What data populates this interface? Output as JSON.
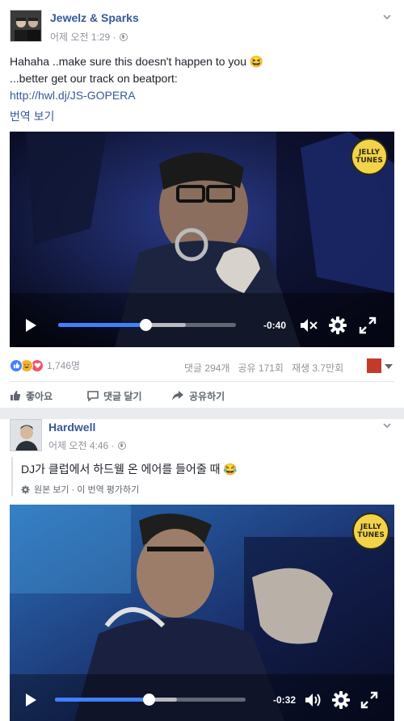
{
  "post1": {
    "author": "Jewelz & Sparks",
    "timestamp": "어제 오전 1:29 ·",
    "text_line1": "Hahaha ..make sure this doesn't happen to you 😆",
    "text_line2": "...better get our track on beatport:",
    "link": "http://hwl.dj/JS-GOPERA",
    "translate": "번역 보기",
    "video": {
      "badge_line1": "JELLY",
      "badge_line2": "TUNES",
      "time": "-0:40",
      "progress": 0.49,
      "buffered": 0.72
    },
    "reaction_count": "1,746명",
    "comments": "댓글 294개",
    "shares": "공유 171회",
    "views": "재생 3.7만회",
    "actions": {
      "like": "좋아요",
      "comment": "댓글 달기",
      "share": "공유하기"
    }
  },
  "post2": {
    "author": "Hardwell",
    "timestamp": "어제 오전 4:46 ·",
    "text": "DJ가 클럽에서 하드웰 온 에어를 들어줄 때 😂",
    "see_original": "원본 보기 · 이 번역 평가하기",
    "video": {
      "badge_line1": "JELLY",
      "badge_line2": "TUNES",
      "time": "-0:32",
      "progress": 0.49,
      "buffered": 0.64
    }
  },
  "colors": {
    "link": "#365899",
    "seek": "#4080ff",
    "muted": "#90949c",
    "like": "#4080ff",
    "haha": "#f7b125",
    "love": "#f25268"
  }
}
